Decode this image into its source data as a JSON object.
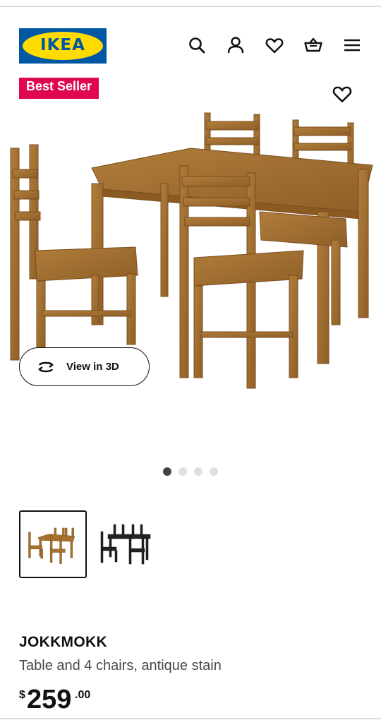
{
  "brand": {
    "logo_text": "IKEA",
    "primary_color": "#0058a3",
    "secondary_color": "#ffdb00"
  },
  "header": {
    "icons": [
      "search-icon",
      "account-icon",
      "wishlist-heart-icon",
      "shopping-basket-icon",
      "menu-icon"
    ]
  },
  "media": {
    "badge": "Best Seller",
    "badge_color": "#e00751",
    "view_3d_label": "View in 3D",
    "carousel": {
      "total": 4,
      "active": 1
    }
  },
  "thumbnails": [
    {
      "variant": "antique stain",
      "selected": true
    },
    {
      "variant": "black",
      "selected": false
    }
  ],
  "product": {
    "name": "JOKKMOKK",
    "description": "Table and 4 chairs, antique stain",
    "price": {
      "currency": "$",
      "integer": "259",
      "decimal": ".00"
    }
  }
}
